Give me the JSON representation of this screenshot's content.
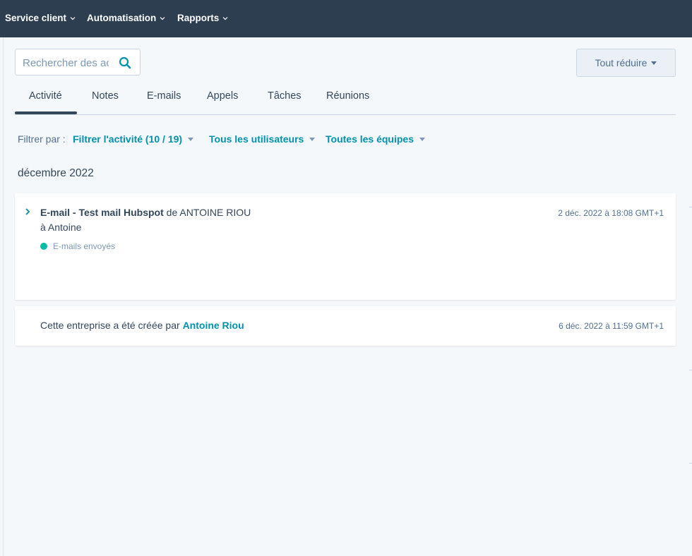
{
  "nav": {
    "items": [
      {
        "label": "Service client"
      },
      {
        "label": "Automatisation"
      },
      {
        "label": "Rapports"
      }
    ]
  },
  "search": {
    "placeholder": "Rechercher des activités",
    "value": ""
  },
  "collapse_button": {
    "label": "Tout réduire"
  },
  "tabs": [
    {
      "label": "Activité",
      "active": true
    },
    {
      "label": "Notes"
    },
    {
      "label": "E-mails"
    },
    {
      "label": "Appels"
    },
    {
      "label": "Tâches"
    },
    {
      "label": "Réunions"
    }
  ],
  "filters": {
    "label": "Filtrer par :",
    "activity": "Filtrer l'activité (10 / 19)",
    "users": "Tous les utilisateurs",
    "teams": "Toutes les équipes"
  },
  "timeline": {
    "month": "décembre 2022",
    "email_event": {
      "subject": "E-mail - Test mail Hubspot",
      "from_word": "de",
      "sender": "ANTOINE RIOU",
      "recipient": "à Antoine",
      "status": "E-mails envoyés",
      "timestamp": "2 déc. 2022 à 18:08 GMT+1"
    },
    "created_event": {
      "text": "Cette entreprise a été créée par",
      "creator": "Antoine Riou",
      "timestamp": "6 déc. 2022 à 11:59 GMT+1"
    }
  },
  "colors": {
    "nav_bg": "#2d3e50",
    "page_bg": "#f5f8fa",
    "link": "#0091ae",
    "status_sent": "#00bda5"
  }
}
